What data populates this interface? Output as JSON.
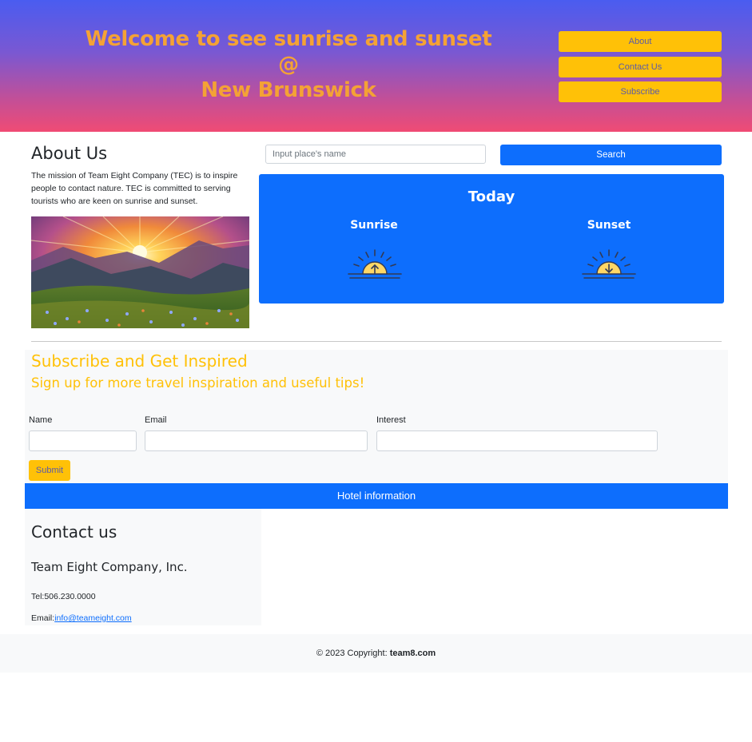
{
  "header": {
    "title_line1": "Welcome to see sunrise and sunset",
    "title_line2": "@",
    "title_line3": "New Brunswick",
    "nav": [
      "About",
      "Contact Us",
      "Subscribe"
    ]
  },
  "about": {
    "title": "About Us",
    "text": "The mission of Team Eight Company (TEC) is to inspire people to contact nature. TEC is committed to serving tourists who are keen on sunrise and sunset."
  },
  "search": {
    "placeholder": "Input place's name",
    "button": "Search"
  },
  "today": {
    "title": "Today",
    "sunrise_label": "Sunrise",
    "sunset_label": "Sunset"
  },
  "subscribe": {
    "title": "Subscribe and Get Inspired",
    "subtitle": "Sign up for more travel inspiration and useful tips!",
    "labels": {
      "name": "Name",
      "email": "Email",
      "interest": "Interest"
    },
    "submit": "Submit"
  },
  "hotel": {
    "label": "Hotel information"
  },
  "contact": {
    "title": "Contact us",
    "company": "Team Eight Company, Inc.",
    "tel": "Tel:506.230.0000",
    "email_prefix": "Email:",
    "email": "info@teameight.com"
  },
  "footer": {
    "prefix": "© 2023 Copyright: ",
    "site": "team8.com"
  },
  "colors": {
    "accent_yellow": "#ffc107",
    "primary_blue": "#0d6efd",
    "title_orange": "#f4a235"
  }
}
